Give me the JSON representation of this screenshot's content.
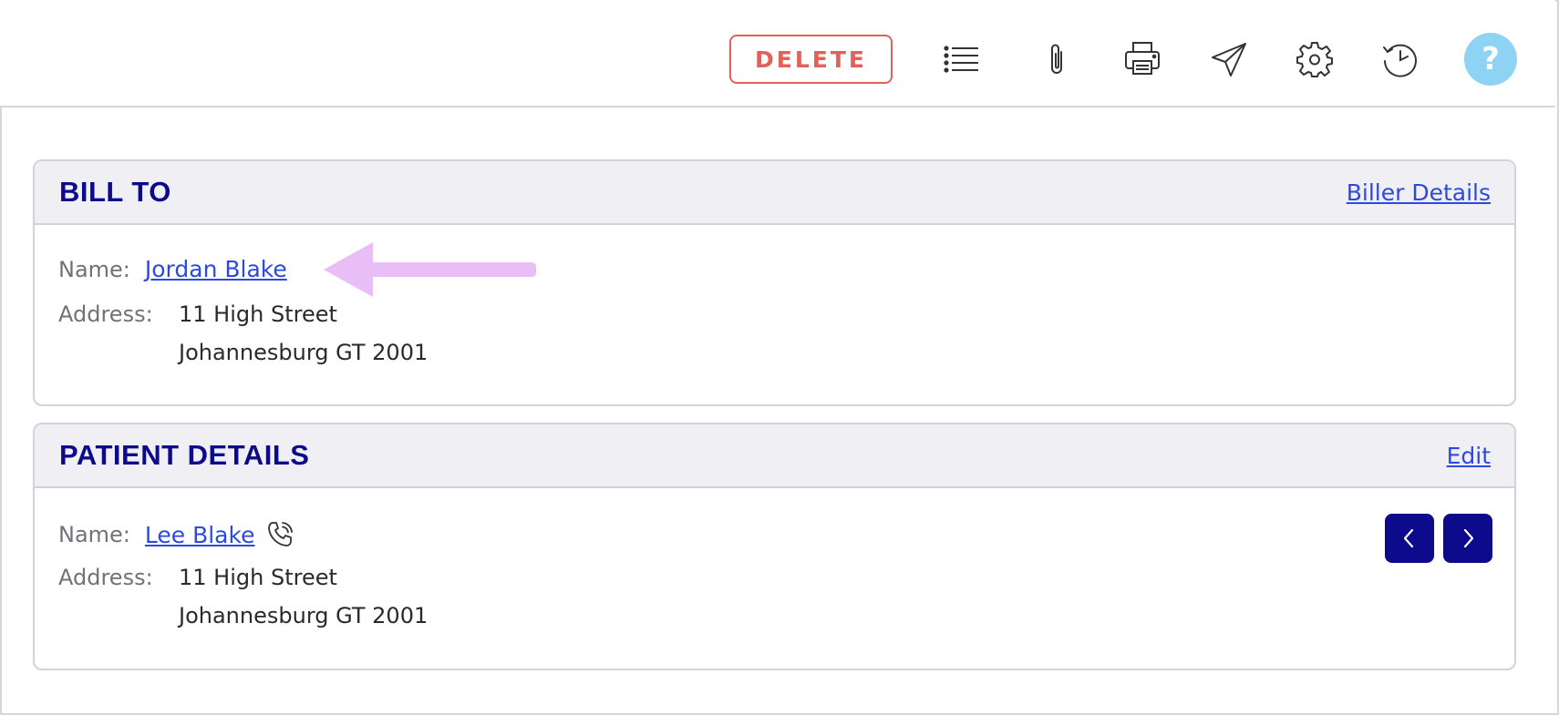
{
  "toolbar": {
    "delete_label": "DELETE",
    "icons": [
      "list-icon",
      "paperclip-icon",
      "printer-icon",
      "send-icon",
      "gear-icon",
      "history-icon"
    ],
    "help_label": "?"
  },
  "bill_to": {
    "title": "BILL TO",
    "link": "Biller Details",
    "name_label": "Name:",
    "name_value": "Jordan Blake",
    "address_label": "Address:",
    "address_line1": "11 High Street",
    "address_line2": "Johannesburg GT 2001"
  },
  "patient": {
    "title": "PATIENT DETAILS",
    "link": "Edit",
    "name_label": "Name:",
    "name_value": "Lee Blake",
    "address_label": "Address:",
    "address_line1": "11 High Street",
    "address_line2": "Johannesburg GT 2001"
  },
  "colors": {
    "accent": "#0d0a8c",
    "link": "#2d49e0",
    "delete": "#e0625a",
    "help": "#8ed3f3",
    "annotation_arrow": "#e9bdf5"
  }
}
